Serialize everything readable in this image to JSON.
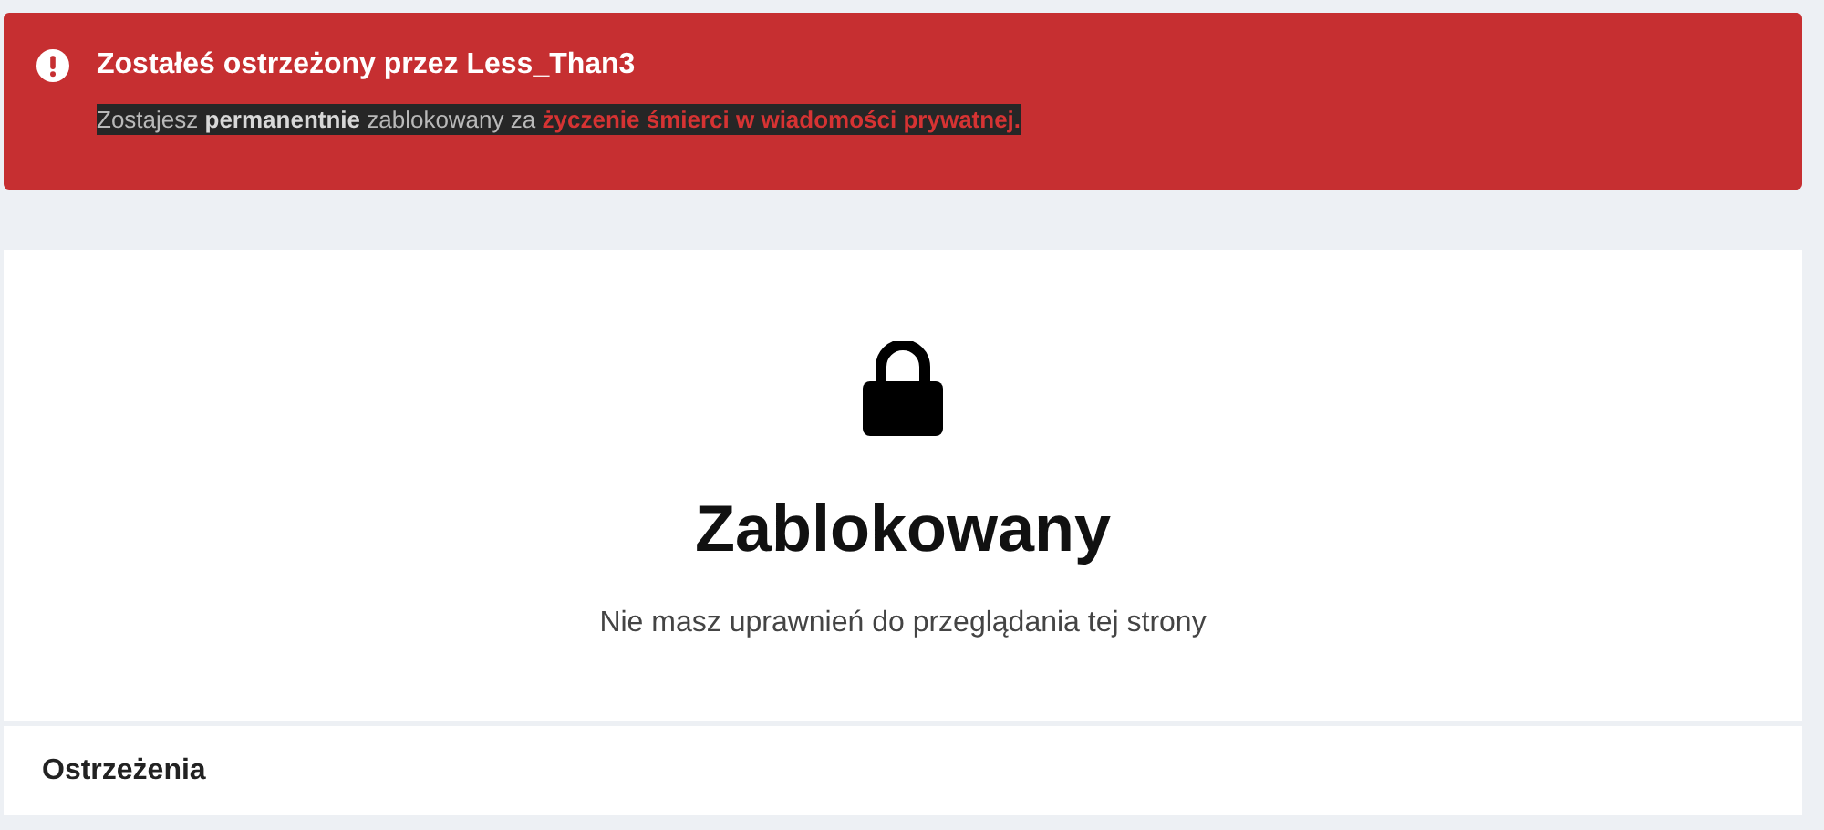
{
  "alert": {
    "title": "Zostałeś ostrzeżony przez Less_Than3",
    "message": "Zostajesz **permanentnie** zablokowany za",
    "reason": "życzenie śmierci w wiadomości prywatnej."
  },
  "blocked": {
    "title": "Zablokowany",
    "subtitle": "Nie masz uprawnień do przeglądania tej strony"
  },
  "warnings": {
    "title": "Ostrzeżenia"
  }
}
